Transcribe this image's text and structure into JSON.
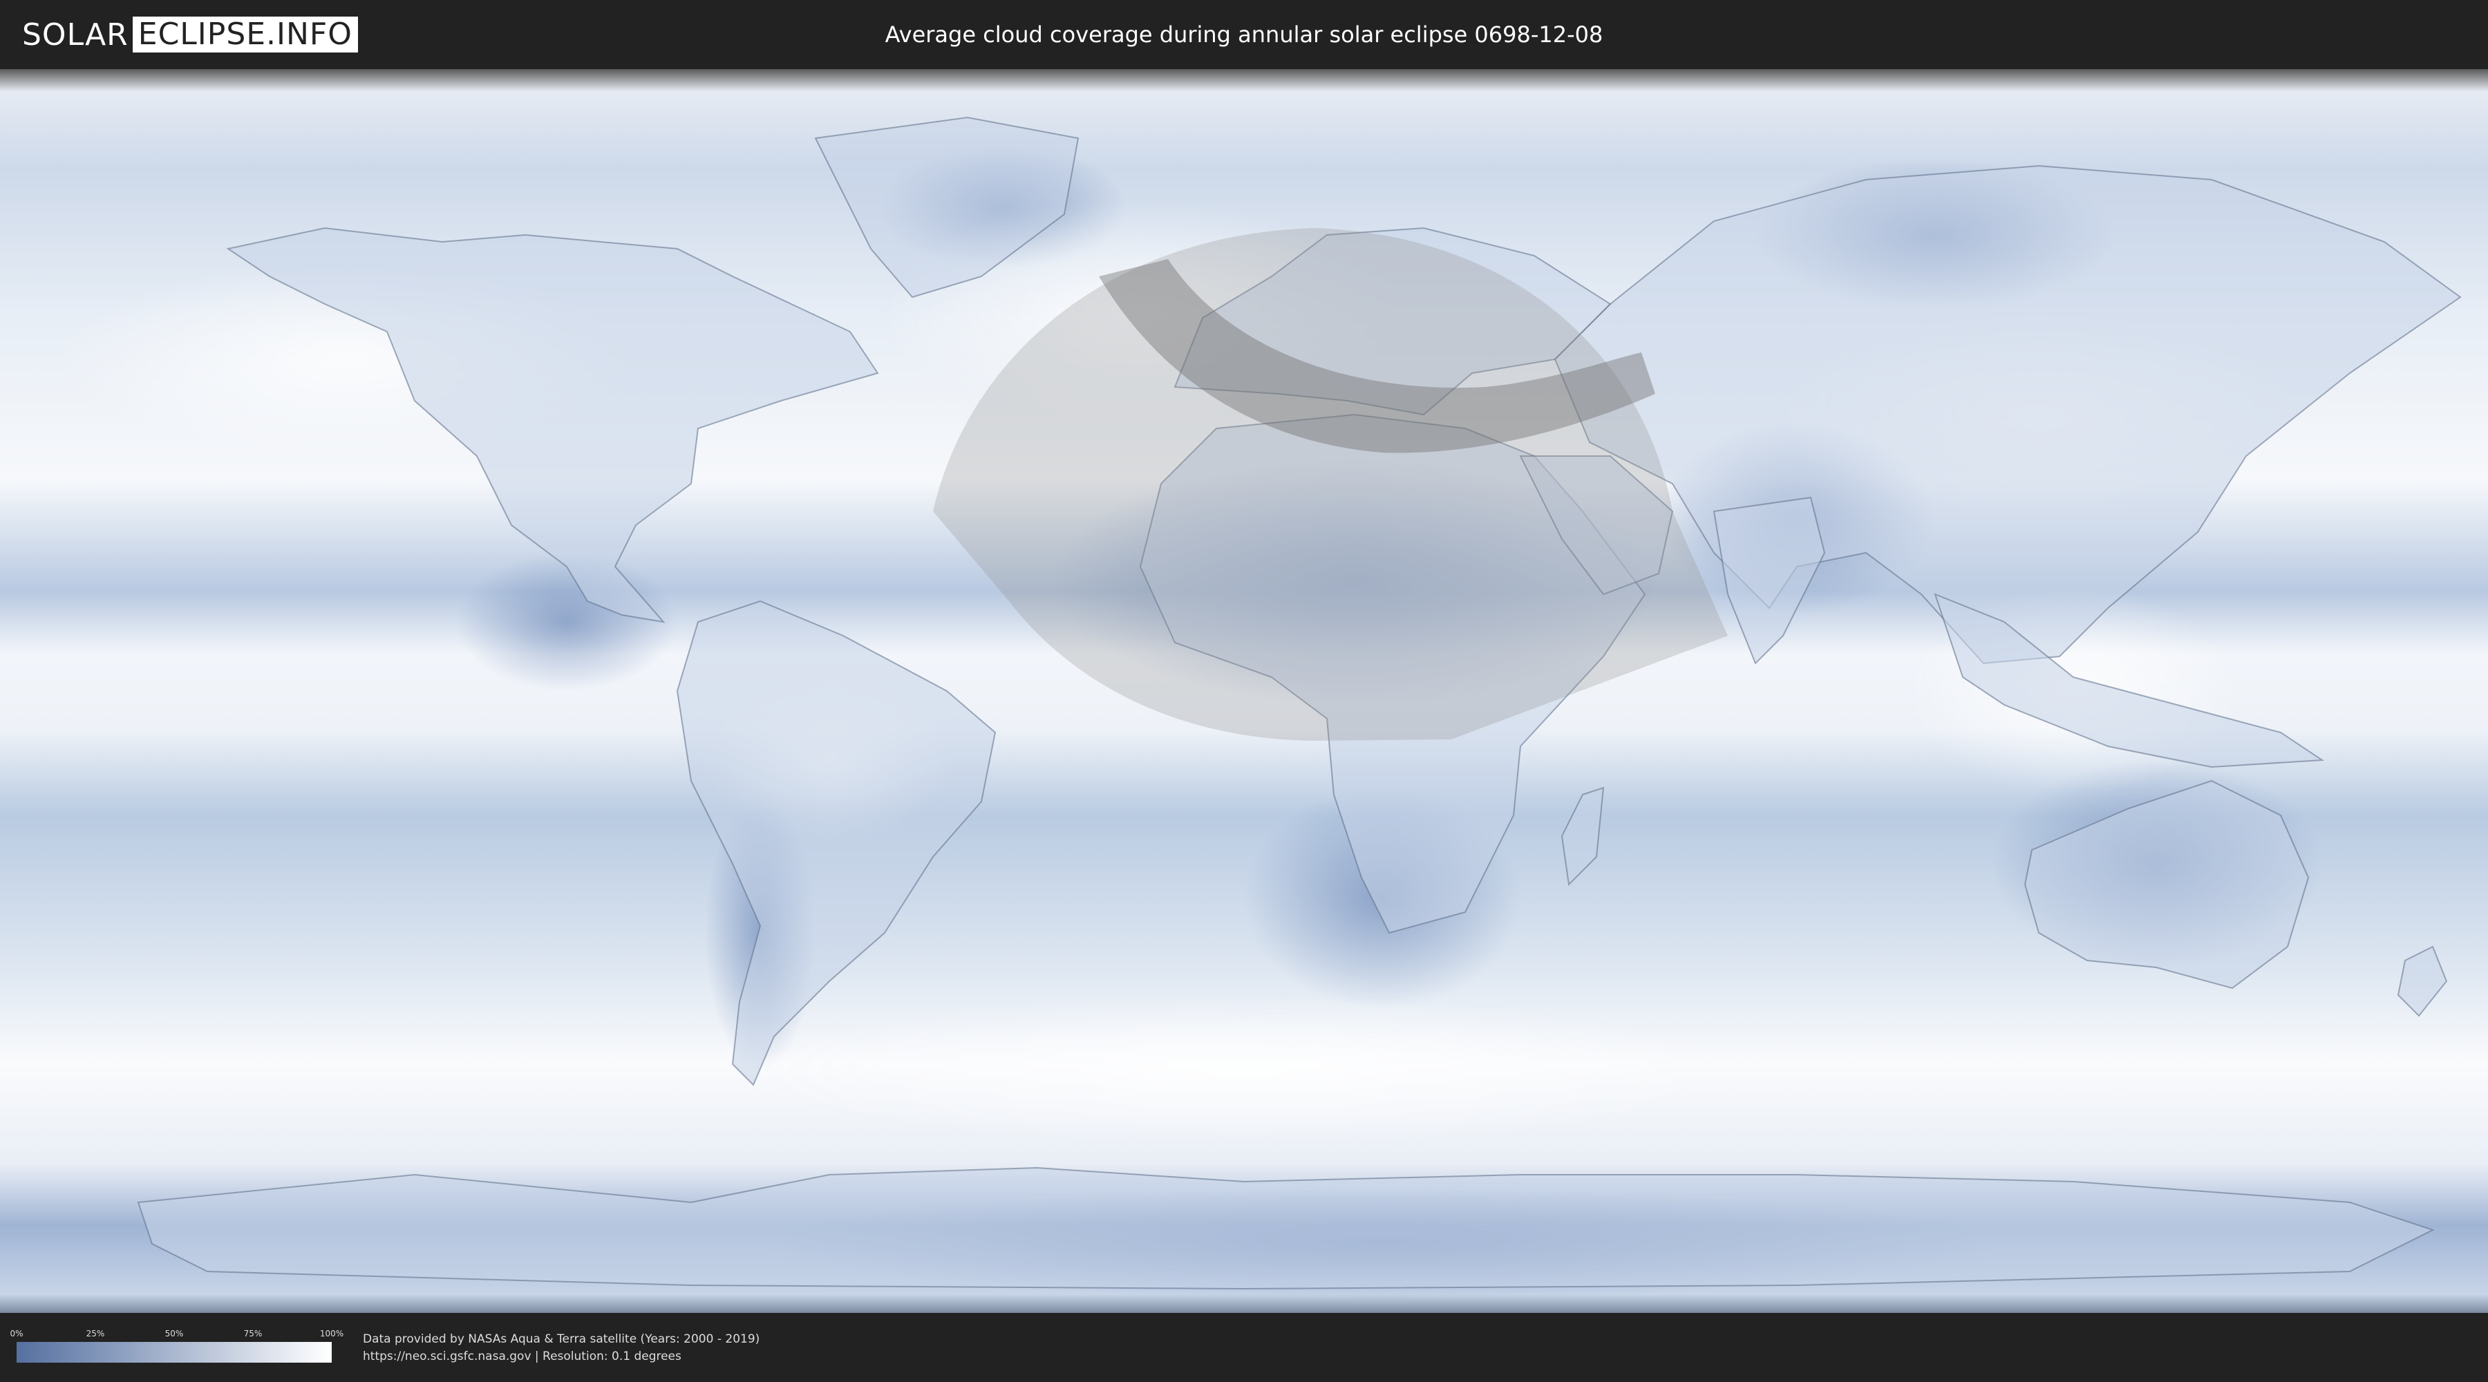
{
  "header": {
    "logo_part1": "SOLAR",
    "logo_part2": "ECLIPSE.INFO",
    "title": "Average cloud coverage during annular solar eclipse 0698-12-08"
  },
  "legend": {
    "ticks": [
      "0%",
      "25%",
      "50%",
      "75%",
      "100%"
    ],
    "tick_values": [
      0,
      25,
      50,
      75,
      100
    ],
    "color_low": "#5570a0",
    "color_high": "#ffffff"
  },
  "credits": {
    "line1": "Data provided by NASAs Aqua & Terra satellite (Years: 2000 - 2019)",
    "line2": "https://neo.sci.gsfc.nasa.gov | Resolution: 0.1 degrees"
  },
  "colors": {
    "background": "#222222",
    "cloud_clear": "#7d97c2",
    "cloud_full": "#ffffff",
    "overlay": "#9a9a9a"
  }
}
